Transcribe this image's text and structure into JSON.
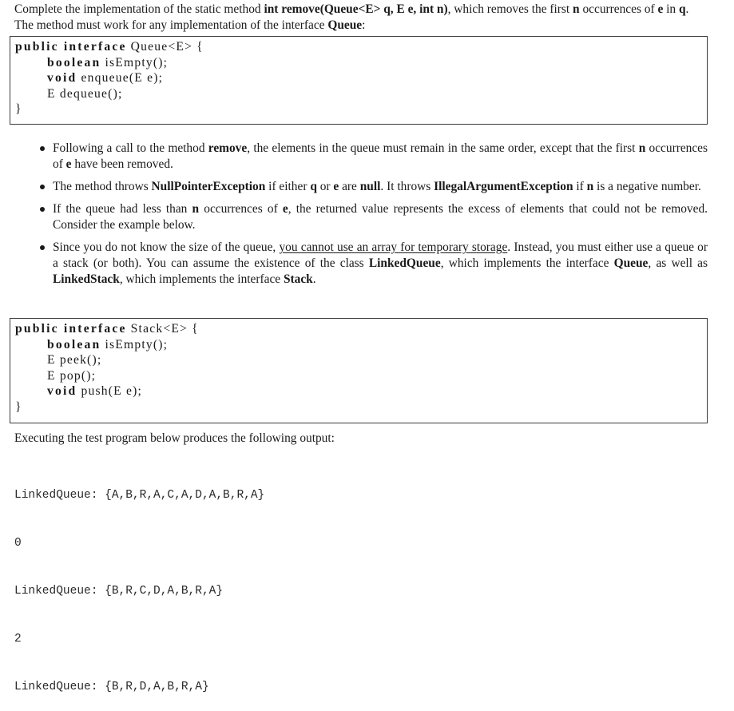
{
  "intro": {
    "t1": "Complete the implementation of the static method ",
    "sig": "int remove(Queue<E> q, E e, int n)",
    "t2": ", which removes the first ",
    "n": "n",
    "t3": " occurrences of ",
    "e": "e",
    "t4": " in ",
    "q": "q",
    "t5": ". The method must work for any implementation of the interface ",
    "queue": "Queue",
    "t6": ":"
  },
  "queue_interface": {
    "decl_kw": "public interface",
    "decl_rest": " Queue<E> {",
    "lines": [
      {
        "kw": "boolean",
        "rest": " isEmpty();"
      },
      {
        "kw": "void",
        "rest": " enqueue(E e);"
      },
      {
        "kw": "",
        "rest": "E dequeue();"
      }
    ],
    "close": "}"
  },
  "bullets": [
    {
      "a": "Following a call to the method ",
      "b1": "remove",
      "c": ", the elements in the queue must remain in the same order, except that the first ",
      "b2": "n",
      "d": " occurrences of ",
      "b3": "e",
      "e": " have been removed."
    },
    {
      "a": "The method throws ",
      "b1": "NullPointerException",
      "c": " if either ",
      "b2": "q",
      "d": " or ",
      "b3": "e",
      "e": " are ",
      "b4": "null",
      "f": ". It throws ",
      "b5": "IllegalArgumentException",
      "g": " if ",
      "b6": "n",
      "h": " is a negative number."
    },
    {
      "a": "If the queue had less than ",
      "b1": "n",
      "c": " occurrences of ",
      "b2": "e",
      "d": ", the returned value represents the excess of elements that could not be removed. Consider the example below."
    },
    {
      "a": "Since you do not know the size of the queue, ",
      "u": "you cannot use an array for temporary storage",
      "c": ". Instead, you must either use a queue or a stack (or both). You can assume the existence of the class ",
      "b1": "LinkedQueue",
      "d": ", which implements the interface ",
      "b2": "Queue",
      "e": ", as well as ",
      "b3": "LinkedStack",
      "f": ", which implements the interface ",
      "b4": "Stack",
      "g": "."
    }
  ],
  "stack_interface": {
    "decl_kw": "public interface",
    "decl_rest": " Stack<E> {",
    "lines": [
      {
        "kw": "boolean",
        "rest": " isEmpty();"
      },
      {
        "kw": "",
        "rest": "E peek();"
      },
      {
        "kw": "",
        "rest": "E pop();"
      },
      {
        "kw": "void",
        "rest": " push(E e);"
      }
    ],
    "close": "}"
  },
  "output_intro": "Executing the test program below produces the following output:",
  "output_lines": [
    "LinkedQueue: {A,B,R,A,C,A,D,A,B,R,A}",
    "0",
    "LinkedQueue: {B,R,C,D,A,B,R,A}",
    "2",
    "LinkedQueue: {B,R,D,A,B,R,A}"
  ]
}
